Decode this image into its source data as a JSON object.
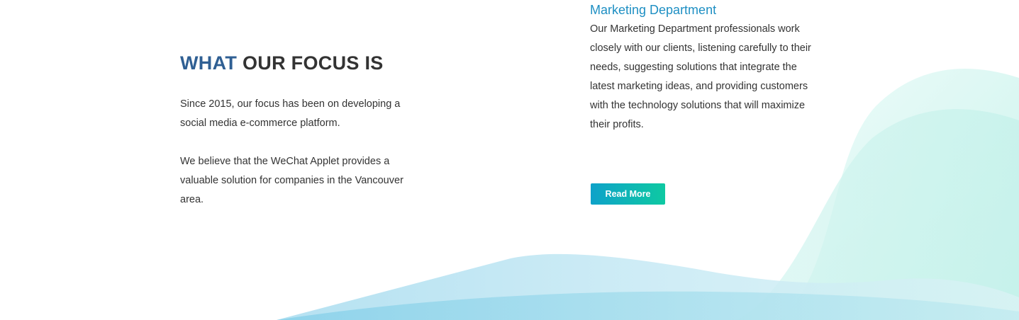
{
  "focus": {
    "title_accent": "WHAT",
    "title_rest": " OUR FOCUS IS",
    "paragraph_1": "Since 2015, our focus has been on developing a social media e-commerce platform.",
    "paragraph_2": "We believe that the WeChat Applet provides a valuable solution for companies in the Vancouver area."
  },
  "department": {
    "title": "Marketing Department",
    "description": "Our Marketing Department professionals work closely with our clients, listening carefully to their needs, suggesting solutions that integrate the latest marketing ideas, and providing customers with the technology solutions that will maximize their profits."
  },
  "read_more": {
    "label": "Read More"
  },
  "colors": {
    "accent_blue": "#2f5f93",
    "department_title": "#1e8fc3",
    "button_gradient_start": "#0ea2c9",
    "button_gradient_end": "#0ec9a2",
    "wave_teal": "#bff0ea",
    "wave_blue": "#8fd5ec"
  }
}
